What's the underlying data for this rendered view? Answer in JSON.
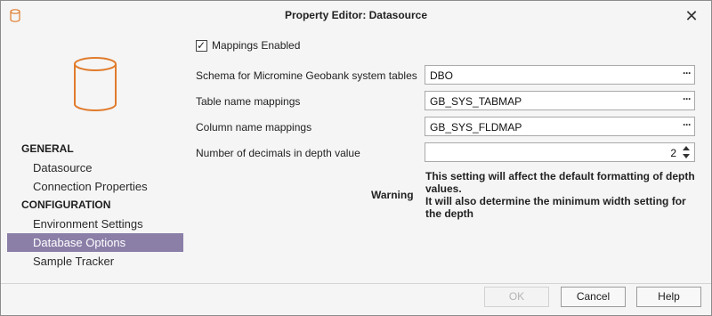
{
  "window": {
    "title": "Property Editor:  Datasource",
    "close_glyph": "✕",
    "app_icon": "database-icon"
  },
  "sidebar": {
    "icon": "database-icon",
    "groups": [
      {
        "label": "GENERAL",
        "items": [
          "Datasource",
          "Connection Properties"
        ]
      },
      {
        "label": "CONFIGURATION",
        "items": [
          "Environment Settings",
          "Database Options",
          "Sample Tracker"
        ]
      }
    ],
    "selected_item": "Database Options",
    "selected_color": "#8b7fa8"
  },
  "form": {
    "mappings_enabled": {
      "label": "Mappings Enabled",
      "checked": true
    },
    "schema": {
      "label": "Schema for Micromine Geobank system tables",
      "value": "DBO"
    },
    "table_mappings": {
      "label": "Table name mappings",
      "value": "GB_SYS_TABMAP"
    },
    "column_mappings": {
      "label": "Column name mappings",
      "value": "GB_SYS_FLDMAP"
    },
    "decimals": {
      "label": "Number of decimals in depth value",
      "value": "2"
    },
    "ellipsis": "···",
    "warning": {
      "label": "Warning",
      "line1": "This setting will affect the default formatting of depth values.",
      "line2": "It will also determine the minimum width setting for the depth"
    }
  },
  "buttons": {
    "ok": "OK",
    "cancel": "Cancel",
    "help": "Help"
  },
  "colors": {
    "icon_orange": "#e07b2c"
  }
}
